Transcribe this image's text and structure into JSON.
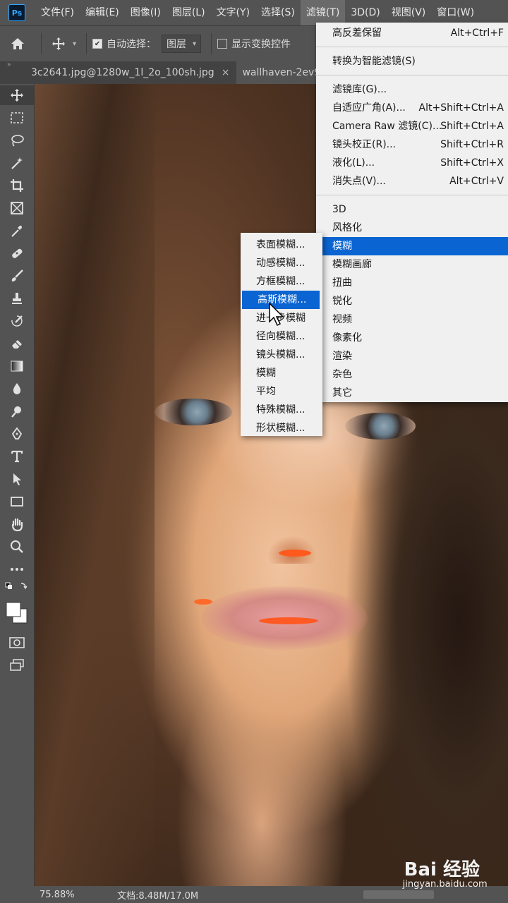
{
  "app": {
    "logo": "Ps"
  },
  "menubar": {
    "items": [
      "文件(F)",
      "编辑(E)",
      "图像(I)",
      "图层(L)",
      "文字(Y)",
      "选择(S)",
      "滤镜(T)",
      "3D(D)",
      "视图(V)",
      "窗口(W)"
    ],
    "active_index": 6
  },
  "options": {
    "auto_select_label": "自动选择：",
    "auto_select_checked": true,
    "layer_dropdown": "图层",
    "show_transform_label": "显示变换控件",
    "show_transform_checked": false
  },
  "tabs": {
    "collapse": "»",
    "items": [
      {
        "label": "3c2641.jpg@1280w_1l_2o_100sh.jpg",
        "close": "×"
      },
      {
        "label": "wallhaven-2ev9",
        "close": ""
      }
    ]
  },
  "filter_menu": {
    "sections": [
      [
        {
          "label": "高反差保留",
          "shortcut": "Alt+Ctrl+F"
        }
      ],
      [
        {
          "label": "转换为智能滤镜(S)",
          "shortcut": ""
        }
      ],
      [
        {
          "label": "滤镜库(G)...",
          "shortcut": ""
        },
        {
          "label": "自适应广角(A)...",
          "shortcut": "Alt+Shift+Ctrl+A"
        },
        {
          "label": "Camera Raw 滤镜(C)...",
          "shortcut": "Shift+Ctrl+A"
        },
        {
          "label": "镜头校正(R)...",
          "shortcut": "Shift+Ctrl+R"
        },
        {
          "label": "液化(L)...",
          "shortcut": "Shift+Ctrl+X"
        },
        {
          "label": "消失点(V)...",
          "shortcut": "Alt+Ctrl+V"
        }
      ],
      [
        {
          "label": "3D",
          "shortcut": ""
        },
        {
          "label": "风格化",
          "shortcut": ""
        },
        {
          "label": "模糊",
          "shortcut": "",
          "highlighted": true
        },
        {
          "label": "模糊画廊",
          "shortcut": ""
        },
        {
          "label": "扭曲",
          "shortcut": ""
        },
        {
          "label": "锐化",
          "shortcut": ""
        },
        {
          "label": "视频",
          "shortcut": ""
        },
        {
          "label": "像素化",
          "shortcut": ""
        },
        {
          "label": "渲染",
          "shortcut": ""
        },
        {
          "label": "杂色",
          "shortcut": ""
        },
        {
          "label": "其它",
          "shortcut": ""
        }
      ]
    ]
  },
  "blur_submenu": {
    "items": [
      "表面模糊...",
      "动感模糊...",
      "方框模糊...",
      "高斯模糊...",
      "进一步模糊",
      "径向模糊...",
      "镜头模糊...",
      "模糊",
      "平均",
      "特殊模糊...",
      "形状模糊..."
    ],
    "highlighted_index": 3
  },
  "status": {
    "zoom": "75.88%",
    "doc": "文档:8.48M/17.0M"
  },
  "watermark": {
    "brand": "Bai  经验",
    "url": "jingyan.baidu.com"
  },
  "colors": {
    "highlight": "#0a64d2",
    "ui_bg": "#535353",
    "menu_bg": "#f0f0f0"
  }
}
